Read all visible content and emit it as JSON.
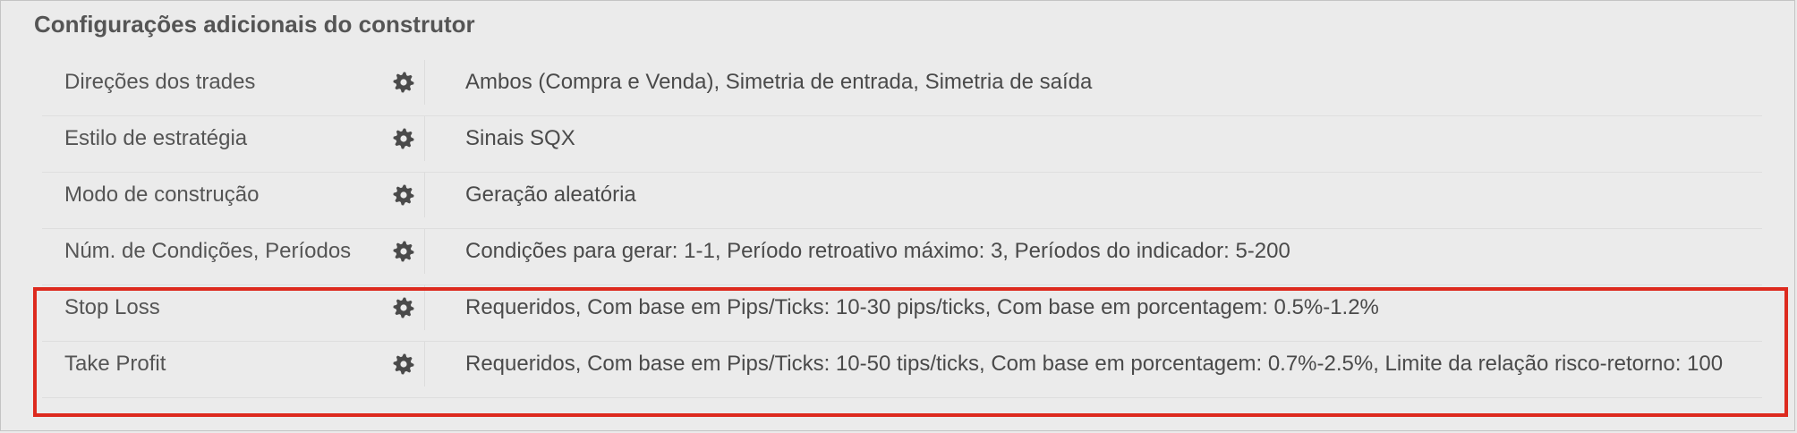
{
  "section": {
    "title": "Configurações adicionais do construtor"
  },
  "colors": {
    "highlight": "#dd2a1e",
    "gear": "#4a4a4a"
  },
  "rows": [
    {
      "label": "Direções dos trades",
      "icon": "gear-icon",
      "value": "Ambos (Compra e Venda), Simetria de entrada, Simetria de saída"
    },
    {
      "label": "Estilo de estratégia",
      "icon": "gear-icon",
      "value": "Sinais SQX"
    },
    {
      "label": "Modo de construção",
      "icon": "gear-icon",
      "value": "Geração aleatória"
    },
    {
      "label": "Núm. de Condições, Períodos",
      "icon": "gear-icon",
      "value": "Condições para gerar: 1-1, Período retroativo máximo: 3, Períodos do indicador: 5-200"
    },
    {
      "label": "Stop Loss",
      "icon": "gear-icon",
      "value": "Requeridos, Com base em Pips/Ticks: 10-30 pips/ticks, Com base em porcentagem: 0.5%-1.2%"
    },
    {
      "label": "Take Profit",
      "icon": "gear-icon",
      "value": "Requeridos, Com base em Pips/Ticks: 10-50 tips/ticks, Com base em porcentagem: 0.7%-2.5%, Limite da relação risco-retorno: 100"
    }
  ]
}
